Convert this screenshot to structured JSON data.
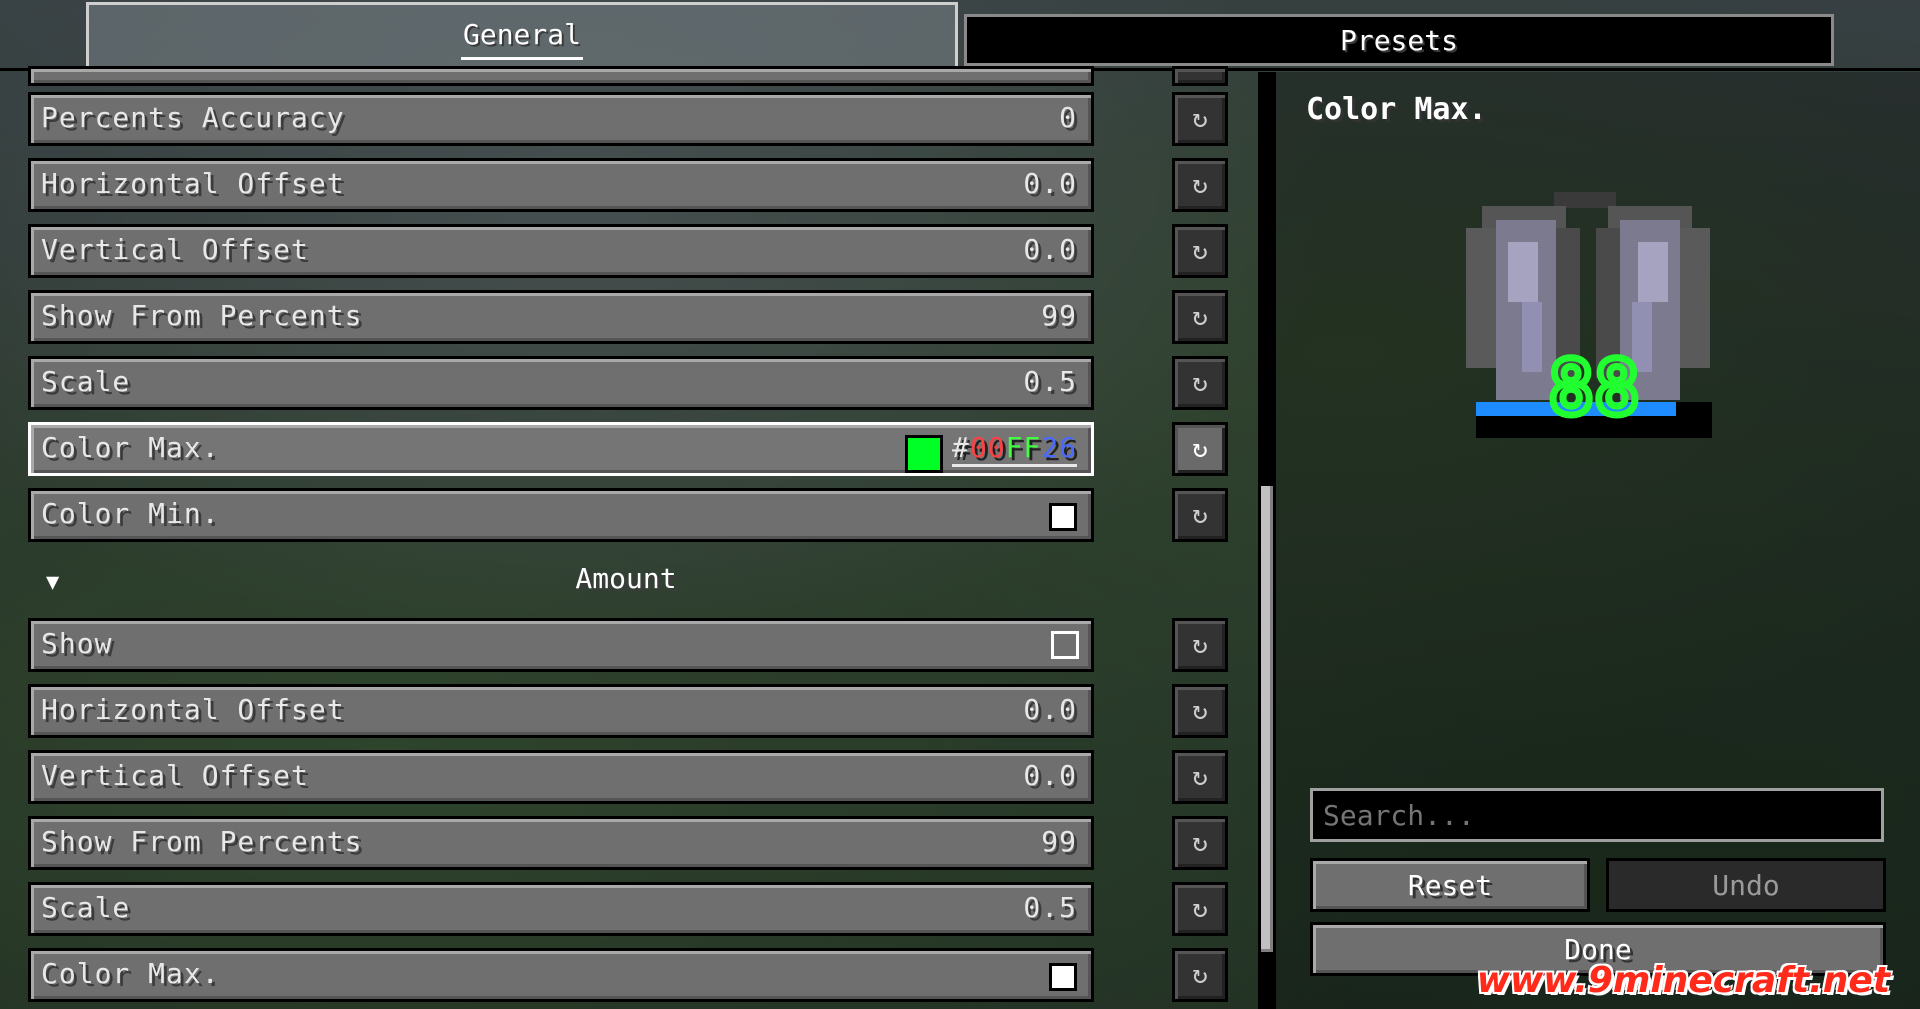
{
  "tabs": {
    "general": "General",
    "presets": "Presets"
  },
  "reset_icon": "↻",
  "rows_top": [
    {
      "label": "Percents Accuracy",
      "value": "0"
    },
    {
      "label": "Horizontal Offset",
      "value": "0.0"
    },
    {
      "label": "Vertical Offset",
      "value": "0.0"
    },
    {
      "label": "Show From Percents",
      "value": "99"
    },
    {
      "label": "Scale",
      "value": "0.5"
    }
  ],
  "color_max": {
    "label": "Color Max.",
    "hash": "#",
    "r": "00",
    "g": "FF",
    "b": "26",
    "swatch_color": "#00ff26"
  },
  "color_min": {
    "label": "Color Min."
  },
  "section": {
    "title": "Amount"
  },
  "rows_bottom": [
    {
      "label": "Horizontal Offset",
      "value": "0.0"
    },
    {
      "label": "Vertical Offset",
      "value": "0.0"
    },
    {
      "label": "Show From Percents",
      "value": "99"
    },
    {
      "label": "Scale",
      "value": "0.5"
    }
  ],
  "show_row": {
    "label": "Show"
  },
  "color_max_bottom": {
    "label": "Color Max."
  },
  "preview": {
    "title": "Color Max.",
    "number": "88"
  },
  "search": {
    "placeholder": "Search..."
  },
  "buttons": {
    "reset": "Reset",
    "undo": "Undo",
    "done": "Done"
  },
  "watermark": "www.9minecraft.net"
}
